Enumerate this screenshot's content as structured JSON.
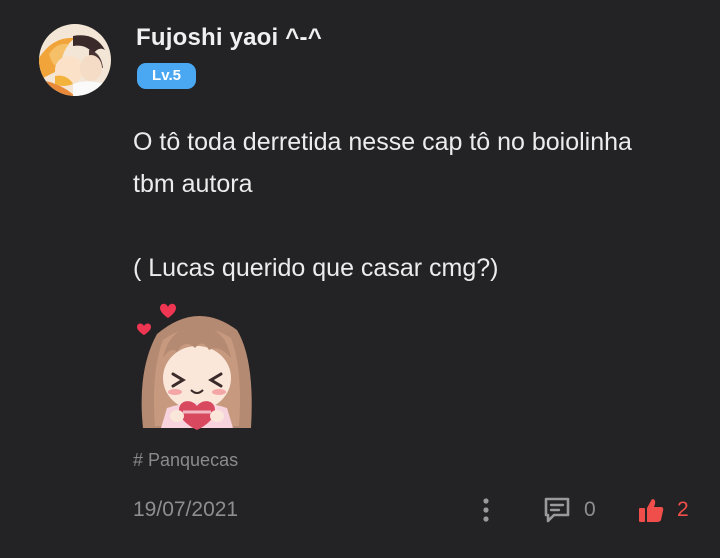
{
  "author": {
    "name": "Fujoshi yaoi ^-^",
    "level": "Lv.5"
  },
  "post": {
    "lines": [
      "O tô toda derretida nesse cap tô no boiolinha",
      "tbm autora",
      "( Lucas querido que casar cmg?)"
    ],
    "tag": "# Panquecas",
    "date": "19/07/2021"
  },
  "actions": {
    "more_icon": "vertical-dots-icon",
    "comment_icon": "comment-icon",
    "comment_count": "0",
    "like_icon": "thumbs-up-icon",
    "like_count": "2"
  },
  "colors": {
    "background": "#232325",
    "badge": "#4aa8f3",
    "like": "#ef4e4a",
    "muted": "#8e8e92"
  }
}
